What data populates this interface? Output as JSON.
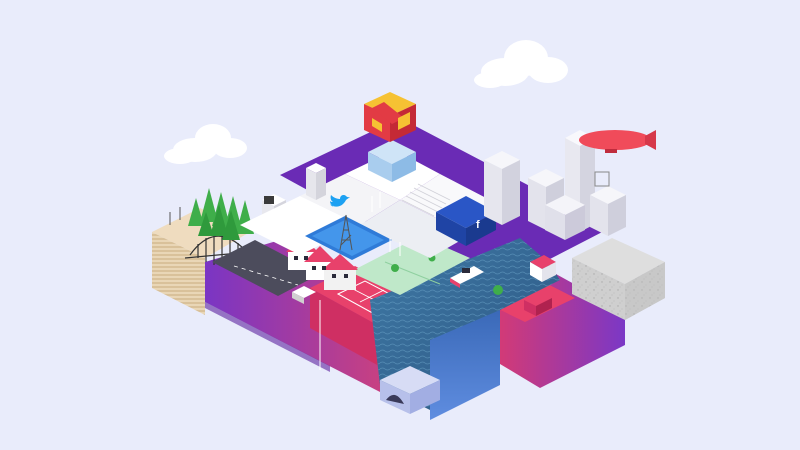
{
  "colors": {
    "background": "#e9ecfb",
    "purple": "#6a2bb5",
    "magenta": "#c2256e",
    "pink": "#e8416b",
    "blue": "#2a56c6",
    "river": "#3b6c9a",
    "green": "#bfe8c9",
    "tree": "#3fae4a",
    "concrete": "#cfcfcf",
    "zeppelin": "#f04b5a",
    "cube_red": "#e23b44",
    "cube_yellow": "#f6c233"
  },
  "icons": {
    "twitter": "twitter-bird-icon",
    "facebook": "facebook-f-icon",
    "instagram": "instagram-camera-icon",
    "notification": "notification-badge-icon"
  },
  "labels": {
    "facebook_glyph": "f",
    "notification_glyph": "!"
  }
}
